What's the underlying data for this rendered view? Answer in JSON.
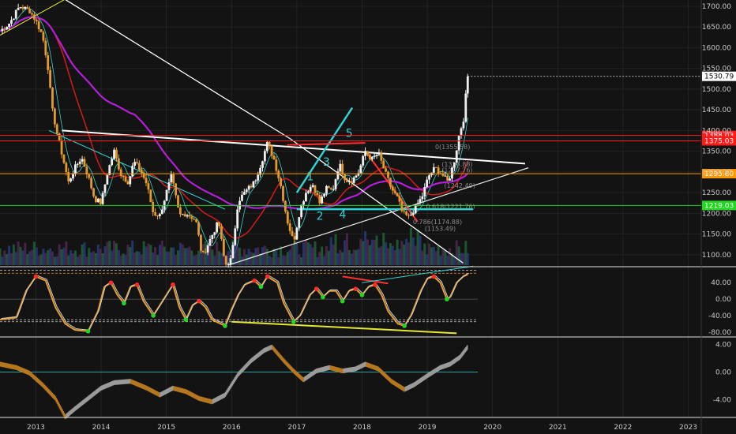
{
  "colors": {
    "background": "#131313",
    "bull_candle": "#f0f0f0",
    "bear_candle": "#e39b2d",
    "red_level": "#ff1a1a",
    "orange_level": "#ff9800",
    "green_level": "#22d622",
    "cyan": "#2fd3d3",
    "magenta": "#b31fd6",
    "red_ma": "#d61a1a",
    "yellow": "#e6e633"
  },
  "chart_data": [
    {
      "type": "candlestick",
      "panel": "price",
      "x_ticks": [
        "2013",
        "2014",
        "2015",
        "2016",
        "2017",
        "2018",
        "2019",
        "2020",
        "2021",
        "2022",
        "2023"
      ],
      "y_ticks": [
        1100,
        1150,
        1200,
        1250,
        1300,
        1350,
        1400,
        1450,
        1500,
        1550,
        1600,
        1650,
        1700
      ],
      "ylim": [
        1075,
        1715
      ],
      "xlim": [
        2012.45,
        2023.2
      ],
      "close_series": [
        [
          2012.45,
          1640
        ],
        [
          2012.6,
          1660
        ],
        [
          2012.75,
          1700
        ],
        [
          2012.9,
          1690
        ],
        [
          2013.0,
          1665
        ],
        [
          2013.1,
          1630
        ],
        [
          2013.18,
          1560
        ],
        [
          2013.25,
          1450
        ],
        [
          2013.33,
          1390
        ],
        [
          2013.42,
          1330
        ],
        [
          2013.5,
          1275
        ],
        [
          2013.6,
          1310
        ],
        [
          2013.7,
          1335
        ],
        [
          2013.8,
          1290
        ],
        [
          2013.9,
          1235
        ],
        [
          2014.0,
          1225
        ],
        [
          2014.1,
          1300
        ],
        [
          2014.2,
          1350
        ],
        [
          2014.3,
          1295
        ],
        [
          2014.42,
          1275
        ],
        [
          2014.5,
          1325
        ],
        [
          2014.6,
          1305
        ],
        [
          2014.7,
          1270
        ],
        [
          2014.8,
          1200
        ],
        [
          2014.9,
          1195
        ],
        [
          2015.0,
          1250
        ],
        [
          2015.08,
          1290
        ],
        [
          2015.2,
          1195
        ],
        [
          2015.3,
          1200
        ],
        [
          2015.45,
          1185
        ],
        [
          2015.55,
          1095
        ],
        [
          2015.65,
          1130
        ],
        [
          2015.8,
          1180
        ],
        [
          2015.9,
          1075
        ],
        [
          2016.0,
          1090
        ],
        [
          2016.1,
          1230
        ],
        [
          2016.2,
          1250
        ],
        [
          2016.35,
          1275
        ],
        [
          2016.45,
          1320
        ],
        [
          2016.55,
          1370
        ],
        [
          2016.65,
          1330
        ],
        [
          2016.75,
          1270
        ],
        [
          2016.85,
          1185
        ],
        [
          2016.95,
          1130
        ],
        [
          2017.05,
          1210
        ],
        [
          2017.15,
          1255
        ],
        [
          2017.25,
          1270
        ],
        [
          2017.35,
          1225
        ],
        [
          2017.45,
          1260
        ],
        [
          2017.55,
          1255
        ],
        [
          2017.65,
          1320
        ],
        [
          2017.75,
          1280
        ],
        [
          2017.85,
          1280
        ],
        [
          2017.95,
          1300
        ],
        [
          2018.05,
          1350
        ],
        [
          2018.15,
          1330
        ],
        [
          2018.25,
          1345
        ],
        [
          2018.35,
          1300
        ],
        [
          2018.45,
          1260
        ],
        [
          2018.55,
          1235
        ],
        [
          2018.62,
          1200
        ],
        [
          2018.72,
          1190
        ],
        [
          2018.82,
          1215
        ],
        [
          2018.92,
          1240
        ],
        [
          2019.02,
          1290
        ],
        [
          2019.12,
          1310
        ],
        [
          2019.22,
          1295
        ],
        [
          2019.32,
          1275
        ],
        [
          2019.42,
          1330
        ],
        [
          2019.5,
          1400
        ],
        [
          2019.55,
          1420
        ],
        [
          2019.62,
          1530
        ]
      ],
      "horizontal_levels": [
        {
          "value": 1388.03,
          "label": "1388.03",
          "color": "#ff1a1a"
        },
        {
          "value": 1375.03,
          "label": "1375.03",
          "color": "#ff1a1a"
        },
        {
          "value": 1295.8,
          "label": "1295.80",
          "color": "#ff9800"
        },
        {
          "value": 1219.03,
          "label": "1219.03",
          "color": "#22d622"
        }
      ],
      "last_price": {
        "value": 1530.79,
        "label": "1530.79"
      },
      "wave_labels": [
        {
          "text": "1",
          "x": 2017.15,
          "y": 1280
        },
        {
          "text": "2",
          "x": 2017.3,
          "y": 1185
        },
        {
          "text": "3",
          "x": 2017.4,
          "y": 1315
        },
        {
          "text": "4",
          "x": 2017.65,
          "y": 1188
        },
        {
          "text": "5",
          "x": 2017.75,
          "y": 1385
        }
      ],
      "fib_labels": [
        {
          "text": "0(1355.58)",
          "x": 2019.12,
          "y": 1355
        },
        {
          "text": "(1313.88)",
          "x": 2019.22,
          "y": 1313
        },
        {
          "text": "(1277.76)",
          "x": 2019.22,
          "y": 1299
        },
        {
          "text": "(1242.49)",
          "x": 2019.26,
          "y": 1262
        },
        {
          "text": "0.618(1221.76)",
          "x": 2018.98,
          "y": 1211
        },
        {
          "text": "0.786(1174.88)",
          "x": 2018.78,
          "y": 1174
        },
        {
          "text": "(1153.49)",
          "x": 2018.96,
          "y": 1158
        }
      ]
    },
    {
      "type": "line",
      "panel": "oscillator_1",
      "y_ticks": [
        40,
        0,
        -40,
        -80
      ],
      "y_tick_labels": [
        "40.00",
        "0.00",
        "-40.00",
        "-80.00"
      ],
      "ylim": [
        -90,
        75
      ],
      "series": [
        {
          "values": [
            [
              2012.45,
              -50
            ],
            [
              2012.7,
              -45
            ],
            [
              2012.85,
              20
            ],
            [
              2013.0,
              55
            ],
            [
              2013.15,
              45
            ],
            [
              2013.3,
              -20
            ],
            [
              2013.45,
              -60
            ],
            [
              2013.6,
              -75
            ],
            [
              2013.8,
              -78
            ],
            [
              2013.95,
              -30
            ],
            [
              2014.05,
              30
            ],
            [
              2014.15,
              40
            ],
            [
              2014.25,
              10
            ],
            [
              2014.35,
              -10
            ],
            [
              2014.45,
              30
            ],
            [
              2014.55,
              35
            ],
            [
              2014.65,
              -5
            ],
            [
              2014.8,
              -40
            ],
            [
              2015.0,
              10
            ],
            [
              2015.1,
              35
            ],
            [
              2015.2,
              -20
            ],
            [
              2015.3,
              -50
            ],
            [
              2015.4,
              -15
            ],
            [
              2015.5,
              -5
            ],
            [
              2015.6,
              -20
            ],
            [
              2015.7,
              -50
            ],
            [
              2015.9,
              -65
            ],
            [
              2016.0,
              -25
            ],
            [
              2016.1,
              10
            ],
            [
              2016.2,
              35
            ],
            [
              2016.35,
              45
            ],
            [
              2016.45,
              30
            ],
            [
              2016.55,
              55
            ],
            [
              2016.7,
              40
            ],
            [
              2016.8,
              -10
            ],
            [
              2016.95,
              -55
            ],
            [
              2017.05,
              -40
            ],
            [
              2017.2,
              10
            ],
            [
              2017.3,
              25
            ],
            [
              2017.4,
              5
            ],
            [
              2017.5,
              20
            ],
            [
              2017.6,
              20
            ],
            [
              2017.7,
              -5
            ],
            [
              2017.8,
              20
            ],
            [
              2017.9,
              25
            ],
            [
              2018.0,
              10
            ],
            [
              2018.1,
              30
            ],
            [
              2018.2,
              35
            ],
            [
              2018.3,
              10
            ],
            [
              2018.4,
              -30
            ],
            [
              2018.55,
              -60
            ],
            [
              2018.65,
              -65
            ],
            [
              2018.75,
              -40
            ],
            [
              2018.9,
              20
            ],
            [
              2019.0,
              50
            ],
            [
              2019.1,
              55
            ],
            [
              2019.2,
              40
            ],
            [
              2019.3,
              0
            ],
            [
              2019.35,
              5
            ],
            [
              2019.45,
              40
            ],
            [
              2019.55,
              55
            ],
            [
              2019.62,
              60
            ]
          ]
        }
      ]
    },
    {
      "type": "area",
      "panel": "oscillator_2",
      "y_ticks": [
        4,
        0,
        -4
      ],
      "y_tick_labels": [
        "4.00",
        "0.00",
        "-4.00"
      ],
      "ylim": [
        -6.5,
        5
      ],
      "series": [
        {
          "values": [
            [
              2012.45,
              1.5
            ],
            [
              2012.7,
              1.0
            ],
            [
              2012.9,
              0.2
            ],
            [
              2013.1,
              -1.5
            ],
            [
              2013.3,
              -3.5
            ],
            [
              2013.45,
              -6.2
            ],
            [
              2013.6,
              -5.0
            ],
            [
              2013.8,
              -3.5
            ],
            [
              2014.0,
              -2.0
            ],
            [
              2014.2,
              -1.2
            ],
            [
              2014.45,
              -1.0
            ],
            [
              2014.7,
              -2.0
            ],
            [
              2014.9,
              -3.0
            ],
            [
              2015.1,
              -2.0
            ],
            [
              2015.3,
              -2.5
            ],
            [
              2015.5,
              -3.5
            ],
            [
              2015.7,
              -4.0
            ],
            [
              2015.9,
              -3.0
            ],
            [
              2016.1,
              0.0
            ],
            [
              2016.3,
              2.0
            ],
            [
              2016.5,
              3.5
            ],
            [
              2016.62,
              4.0
            ],
            [
              2016.8,
              2.0
            ],
            [
              2016.95,
              0.5
            ],
            [
              2017.1,
              -0.8
            ],
            [
              2017.3,
              0.5
            ],
            [
              2017.5,
              1.0
            ],
            [
              2017.7,
              0.5
            ],
            [
              2017.9,
              0.8
            ],
            [
              2018.05,
              1.5
            ],
            [
              2018.25,
              0.8
            ],
            [
              2018.45,
              -1.0
            ],
            [
              2018.65,
              -2.2
            ],
            [
              2018.8,
              -1.5
            ],
            [
              2019.0,
              -0.2
            ],
            [
              2019.2,
              1.0
            ],
            [
              2019.35,
              1.5
            ],
            [
              2019.5,
              2.5
            ],
            [
              2019.62,
              4.0
            ]
          ]
        }
      ]
    }
  ]
}
